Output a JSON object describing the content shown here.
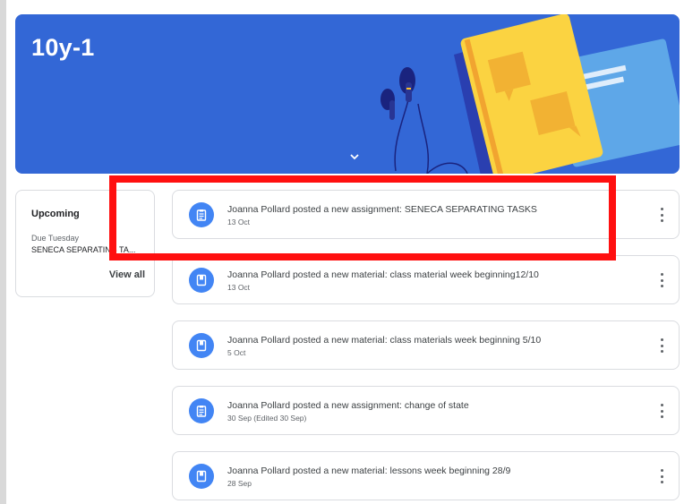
{
  "banner": {
    "title": "10y-1"
  },
  "upcoming": {
    "title": "Upcoming",
    "due_label": "Due Tuesday",
    "item": "SENECA SEPARATING TA...",
    "view_all": "View all"
  },
  "feed": [
    {
      "type": "assignment",
      "text": "Joanna Pollard posted a new assignment: SENECA SEPARATING TASKS",
      "date": "13 Oct"
    },
    {
      "type": "material",
      "text": "Joanna Pollard posted a new material: class material week beginning12/10",
      "date": "13 Oct"
    },
    {
      "type": "material",
      "text": "Joanna Pollard posted a new material: class materials week beginning 5/10",
      "date": "5 Oct"
    },
    {
      "type": "assignment",
      "text": "Joanna Pollard posted a new assignment: change of state",
      "date": "30 Sep (Edited 30 Sep)"
    },
    {
      "type": "material",
      "text": "Joanna Pollard posted a new material: lessons week beginning 28/9",
      "date": "28 Sep"
    }
  ],
  "colors": {
    "banner": "#3367d6",
    "icon": "#4285f4",
    "highlight": "#ff1010"
  },
  "icons": {
    "assignment": "assignment-icon",
    "material": "book-icon",
    "menu": "more-vert-icon"
  }
}
